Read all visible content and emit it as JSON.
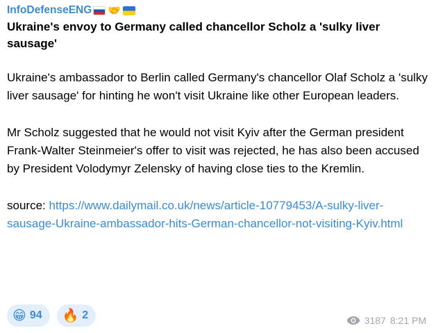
{
  "channel": {
    "name": "InfoDefenseENG",
    "flags": [
      "russia-flag",
      "handshake",
      "ukraine-flag"
    ]
  },
  "post": {
    "title": "Ukraine's envoy to Germany called chancellor Scholz a 'sulky liver sausage'",
    "paragraphs": [
      "Ukraine's ambassador to Berlin called Germany's chancellor Olaf Scholz a 'sulky liver sausage' for hinting he won't visit Ukraine like other European leaders.",
      "Mr Scholz suggested that he would not visit Kyiv after the German president Frank-Walter Steinmeier's offer to visit was rejected, he has also been accused by President Volodymyr Zelensky of having close ties to the Kremlin."
    ],
    "source_label": "source:",
    "source_url": "https://www.dailymail.co.uk/news/article-10779453/A-sulky-liver-sausage-Ukraine-ambassador-hits-German-chancellor-not-visiting-Kyiv.html"
  },
  "reactions": [
    {
      "emoji": "😁",
      "icon": "grinning-face-icon",
      "count": "94"
    },
    {
      "emoji": "🔥",
      "icon": "fire-icon",
      "count": "2"
    }
  ],
  "meta": {
    "views": "3187",
    "time": "8:21 PM"
  },
  "colors": {
    "accent": "#3a8bd1",
    "reaction_bg": "#e3eefb",
    "meta_text": "#9fa6ad"
  }
}
